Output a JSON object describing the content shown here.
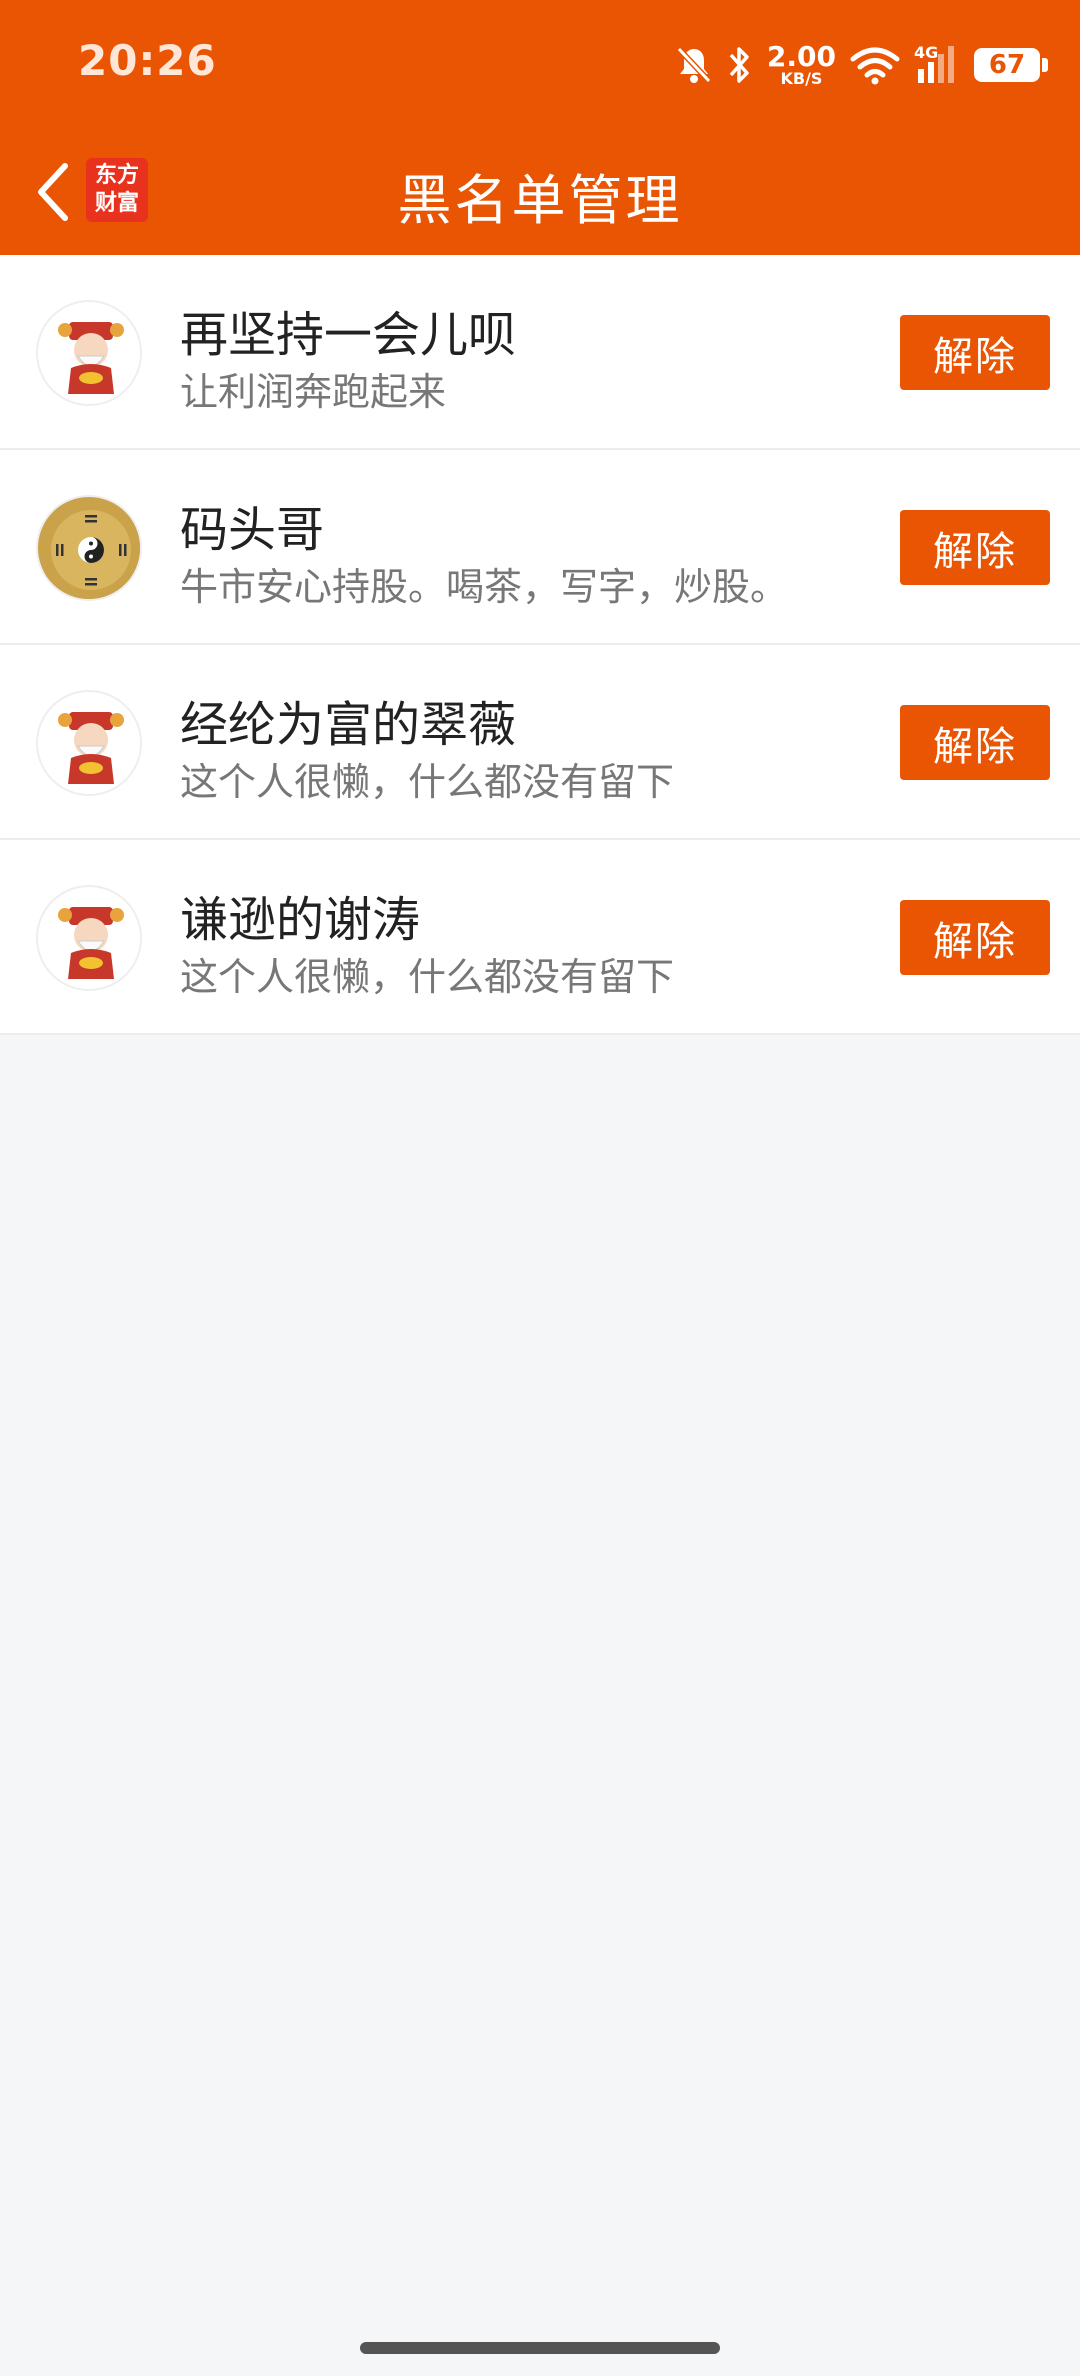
{
  "status_bar": {
    "time": "20:26",
    "net_speed_value": "2.00",
    "net_speed_unit": "KB/S",
    "network_type": "4G",
    "battery": "67"
  },
  "header": {
    "back_icon": "chevron-left-icon",
    "logo_line1": "东方",
    "logo_line2": "财富",
    "title": "黑名单管理"
  },
  "blacklist": [
    {
      "name": "再坚持一会儿呗",
      "desc": "让利润奔跑起来",
      "action": "解除",
      "avatar": "god-of-wealth"
    },
    {
      "name": "码头哥",
      "desc": "牛市安心持股。喝茶，写字，炒股。",
      "action": "解除",
      "avatar": "bagua-taiji"
    },
    {
      "name": "经纶为富的翠薇",
      "desc": "这个人很懒，什么都没有留下",
      "action": "解除",
      "avatar": "god-of-wealth"
    },
    {
      "name": "谦逊的谢涛",
      "desc": "这个人很懒，什么都没有留下",
      "action": "解除",
      "avatar": "god-of-wealth"
    }
  ],
  "colors": {
    "brand_orange": "#ea5504",
    "background": "#f5f6f8"
  }
}
